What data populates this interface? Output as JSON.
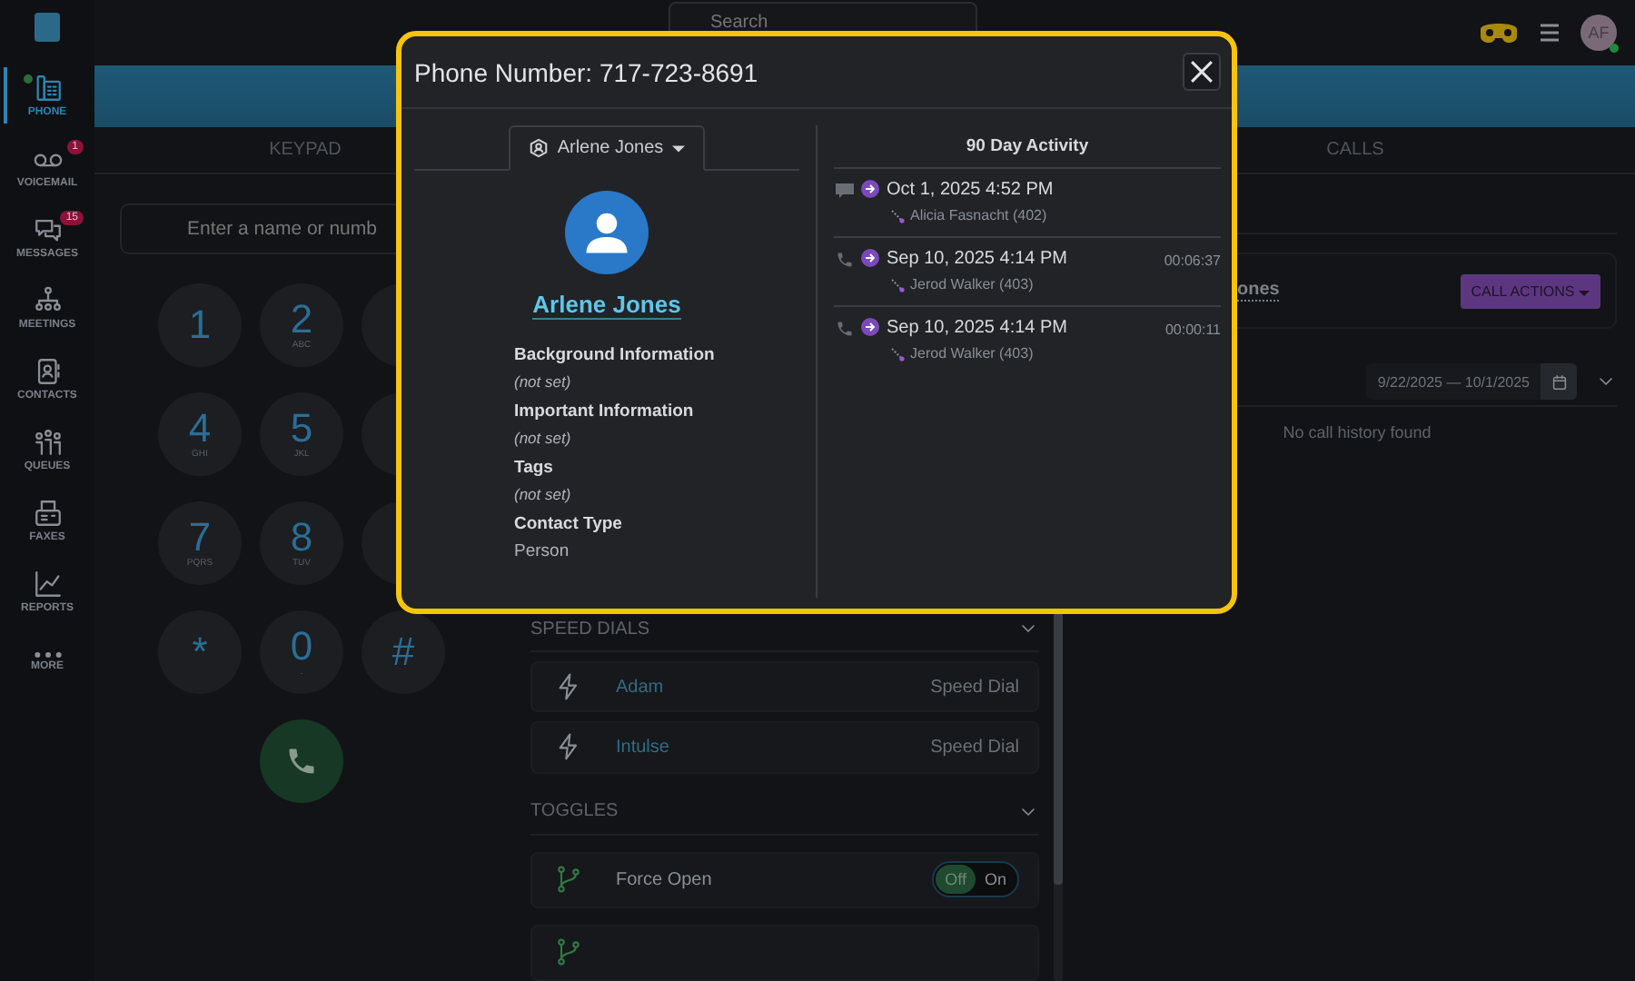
{
  "topbar": {
    "search": {
      "placeholder": "Search"
    },
    "avatar": {
      "initials": "AF",
      "online": true
    }
  },
  "sidebar": {
    "items": [
      {
        "kind": "phone",
        "label": "PHONE",
        "selected": true,
        "status_dot": true
      },
      {
        "kind": "voicemail",
        "label": "VOICEMAIL",
        "selected": false,
        "status_dot": false,
        "badge": "1"
      },
      {
        "kind": "messages",
        "label": "MESSAGES",
        "selected": false,
        "status_dot": false,
        "badge": "15"
      },
      {
        "kind": "meetings",
        "label": "MEETINGS",
        "selected": false,
        "status_dot": false
      },
      {
        "kind": "contacts",
        "label": "CONTACTS",
        "selected": false,
        "status_dot": false
      },
      {
        "kind": "queues",
        "label": "QUEUES",
        "selected": false,
        "status_dot": false
      },
      {
        "kind": "faxes",
        "label": "FAXES",
        "selected": false,
        "status_dot": false
      },
      {
        "kind": "reports",
        "label": "REPORTS",
        "selected": false,
        "status_dot": false
      },
      {
        "kind": "more",
        "label": "MORE",
        "selected": false,
        "status_dot": false
      }
    ]
  },
  "tabs": [
    {
      "label": "KEYPAD",
      "selected": false
    },
    {
      "label": "CALLS",
      "selected": false
    }
  ],
  "keypad": {
    "field": {
      "placeholder": "Enter a name or numb"
    },
    "keys": [
      {
        "kind": "key",
        "digit": "1"
      },
      {
        "kind": "key",
        "digit": "2",
        "letters": "ABC"
      },
      {
        "kind": "covered"
      },
      {
        "kind": "key",
        "digit": "4",
        "letters": "GHI"
      },
      {
        "kind": "key",
        "digit": "5",
        "letters": "JKL"
      },
      {
        "kind": "covered"
      },
      {
        "kind": "key",
        "digit": "7",
        "letters": "PQRS"
      },
      {
        "kind": "key",
        "digit": "8",
        "letters": "TUV"
      },
      {
        "kind": "covered"
      },
      {
        "kind": "key",
        "digit": "*"
      },
      {
        "kind": "key",
        "digit": "0",
        "letters": "."
      },
      {
        "kind": "key",
        "digit": "#"
      }
    ]
  },
  "speed_dials": {
    "title": "SPEED DIALS",
    "items": [
      {
        "name": "Adam",
        "type": "Speed Dial"
      },
      {
        "name": "Intulse",
        "type": "Speed Dial"
      }
    ]
  },
  "toggles": {
    "title": "TOGGLES",
    "items": [
      {
        "kind": "full",
        "name": "Force Open",
        "off_label": "Off",
        "on_label": "On",
        "on": false
      },
      {
        "kind": "cut"
      }
    ]
  },
  "calls": {
    "contact_name": "ones",
    "call_actions": "CALL ACTIONS",
    "date_range": "9/22/2025 — 10/1/2025",
    "empty": "No call history found"
  },
  "modal": {
    "title": "Phone Number: 717-723-8691",
    "contact_tab": "Arlene Jones",
    "name": "Arlene Jones",
    "fields": [
      {
        "label": "Background Information",
        "value": "(not set)",
        "unset": true
      },
      {
        "label": "Important Information",
        "value": "(not set)",
        "unset": true
      },
      {
        "label": "Tags",
        "value": "(not set)",
        "unset": true
      },
      {
        "label": "Contact Type",
        "value": "Person",
        "unset": false
      }
    ],
    "activity_title": "90 Day Activity",
    "activity": [
      {
        "kind": "message",
        "date": "Oct 1, 2025 4:52 PM",
        "agent": "Alicia Fasnacht (402)"
      },
      {
        "kind": "call",
        "date": "Sep 10, 2025 4:14 PM",
        "agent": "Jerod Walker (403)",
        "duration": "00:06:37"
      },
      {
        "kind": "call",
        "date": "Sep 10, 2025 4:14 PM",
        "agent": "Jerod Walker (403)",
        "duration": "00:00:11"
      }
    ]
  }
}
